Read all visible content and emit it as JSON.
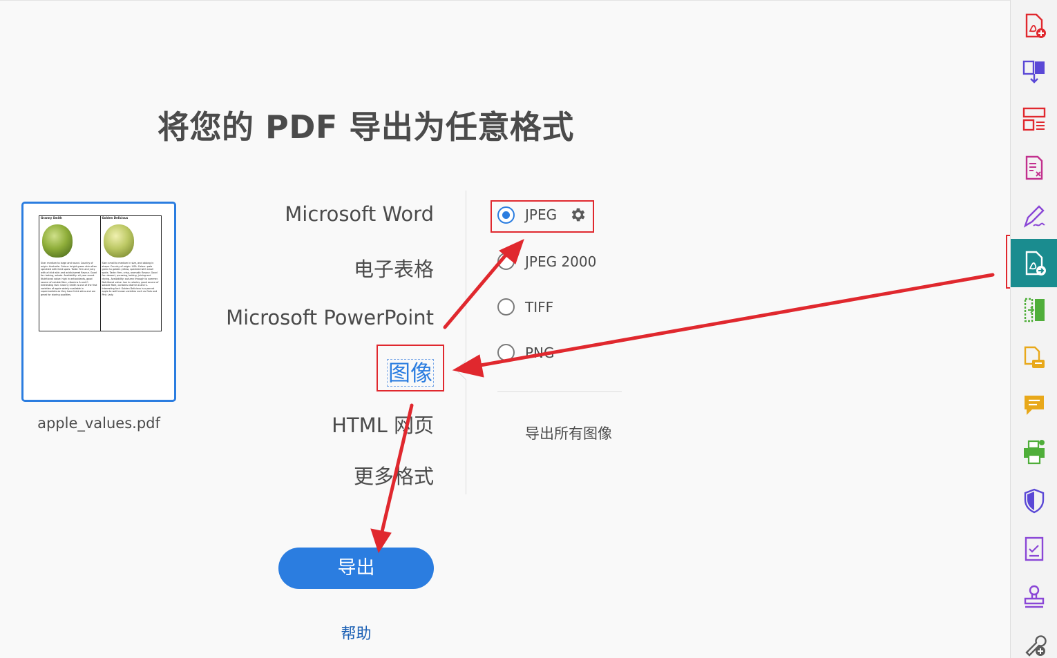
{
  "page": {
    "title": "将您的 PDF 导出为任意格式"
  },
  "file": {
    "name": "apple_values.pdf",
    "thumb": {
      "col1_head": "Granny Smith",
      "col2_head": "Golden Delicious",
      "col1_text": "Size: medium to large and round. Country of origin: Australia. Colour: bright green skin often speckled with faint spots. Taste: firm and juicy with a thick skin and acidic/sweet flavour. Good for: baking, salads. Availability: all year round. Nutritional value: high in antioxidants, good source of soluble fibre, vitamins A and C. Interesting fact: Granny Smith is one of the first varieties of apple widely available in supermarkets as they have thick skins and are great for storing qualities.",
      "col2_text": "Size: small to medium in size, and oblong in shape. Country of origin: USA. Colour: pale green to golden yellow, speckled with small spots. Taste: firm, crisp, aromatic flavour. Good for: dessert, pureeing, baking, juicing and drying. Availability: autumn through to summer. Nutritional value: low in calories, good source of soluble fibre, contains vitamin A and C. Interesting fact: Golden Delicious is a parent apple to well known varieties such as Gala and Pink Lady."
    }
  },
  "formats": [
    {
      "label": "Microsoft Word",
      "selected": false
    },
    {
      "label": "电子表格",
      "selected": false
    },
    {
      "label": "Microsoft PowerPoint",
      "selected": false
    },
    {
      "label": "图像",
      "selected": true
    },
    {
      "label": "HTML 网页",
      "selected": false
    },
    {
      "label": "更多格式",
      "selected": false
    }
  ],
  "image_options": [
    {
      "label": "JPEG",
      "checked": true
    },
    {
      "label": "JPEG 2000",
      "checked": false
    },
    {
      "label": "TIFF",
      "checked": false
    },
    {
      "label": "PNG",
      "checked": false
    }
  ],
  "export_all_images": "导出所有图像",
  "buttons": {
    "export": "导出",
    "help": "帮助"
  },
  "colors": {
    "accent": "#2b7de0",
    "annotation_red": "#e0282e",
    "active_tool": "#1a8c8f"
  },
  "sidebar_tools": [
    "create-pdf-icon",
    "combine-files-icon",
    "organize-pages-icon",
    "edit-pdf-icon",
    "fill-sign-icon",
    "export-pdf-icon",
    "compress-pdf-icon",
    "request-signatures-icon",
    "comment-icon",
    "print-production-icon",
    "protect-icon",
    "prepare-form-icon",
    "stamp-icon",
    "more-tools-icon"
  ]
}
